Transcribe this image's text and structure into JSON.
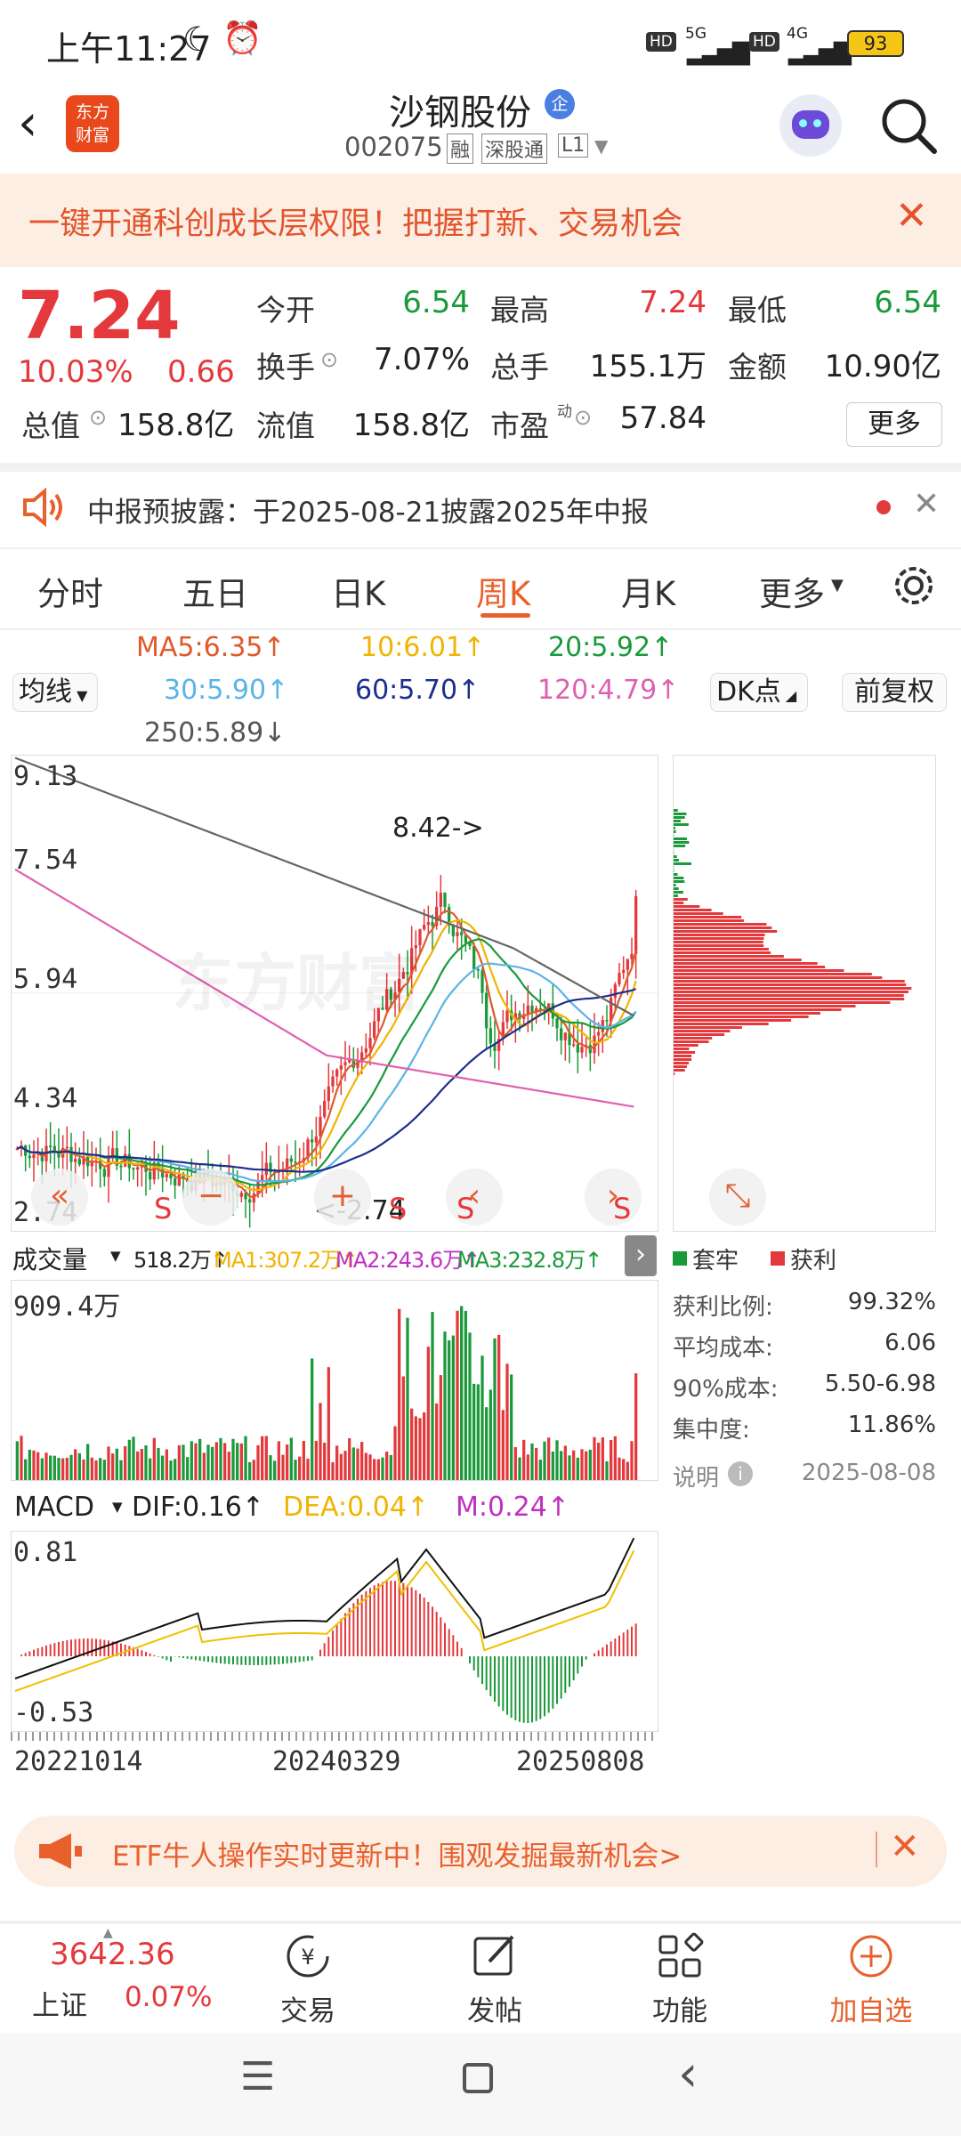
{
  "status": {
    "time": "上午11:27",
    "battery": "93",
    "net1": "5G",
    "net2": "4G",
    "hd1": "HD",
    "hd2": "HD"
  },
  "nav": {
    "logo_line1": "东方",
    "logo_line2": "财富",
    "title": "沙钢股份",
    "title_badge": "企",
    "code": "002075",
    "tag1": "融",
    "tag2": "深股通",
    "tag3": "L1"
  },
  "banner": {
    "text": "一键开通科创成长层权限！把握打新、交易机会"
  },
  "quote": {
    "price": "7.24",
    "change_pct": "10.03%",
    "change": "0.66",
    "labels": {
      "open": "今开",
      "high": "最高",
      "low": "最低",
      "turnover": "换手",
      "volume": "总手",
      "amount": "金额",
      "mcap": "总值",
      "float": "流值",
      "pe": "市盈",
      "pe_sup": "动"
    },
    "values": {
      "open": "6.54",
      "high": "7.24",
      "low": "6.54",
      "turnover": "7.07%",
      "volume": "155.1万",
      "amount": "10.90亿",
      "mcap": "158.8亿",
      "float": "158.8亿",
      "pe": "57.84"
    },
    "more": "更多"
  },
  "notice": {
    "text": "中报预披露：于2025-08-21披露2025年中报"
  },
  "tabs": [
    "分时",
    "五日",
    "日K",
    "周K",
    "月K",
    "更多"
  ],
  "active_tab": "周K",
  "ma": {
    "ma5": "MA5:6.35↑",
    "ma10": "10:6.01↑",
    "ma20": "20:5.92↑",
    "ma30": "30:5.90↑",
    "ma60": "60:5.70↑",
    "ma120": "120:4.79↑",
    "ma250": "250:5.89↓"
  },
  "chips": {
    "junxian": "均线",
    "dk": "DK点",
    "fq": "前复权"
  },
  "colors": {
    "ma5": "#e05a2a",
    "ma10": "#f0b400",
    "ma20": "#1a9a3a",
    "ma30": "#5ab4e6",
    "ma60": "#1c2f8c",
    "ma120": "#e060b0",
    "ma250": "#666666",
    "up": "#e4393c",
    "down": "#1a9a3a"
  },
  "kline": {
    "y_labels": [
      "9.13",
      "7.54",
      "5.94",
      "4.34",
      "2.74"
    ],
    "high_anno": "8.42->",
    "low_anno": "<-2.74",
    "watermark": "东方财富"
  },
  "chip_legend": {
    "trapped": "套牢",
    "profit": "获利"
  },
  "chip_stats": [
    {
      "label": "获利比例:",
      "value": "99.32%"
    },
    {
      "label": "平均成本:",
      "value": "6.06"
    },
    {
      "label": "90%成本:",
      "value": "5.50-6.98"
    },
    {
      "label": "集中度:",
      "value": "11.86%"
    }
  ],
  "chip_note": "说明",
  "chip_date": "2025-08-08",
  "volume": {
    "name": "成交量",
    "v": "518.2万↑",
    "ma1": "MA1:307.2万↑",
    "ma2": "MA2:243.6万↑",
    "ma3": "MA3:232.8万↑",
    "max": "909.4万"
  },
  "macd": {
    "name": "MACD",
    "dif": "DIF:0.16↑",
    "dea": "DEA:0.04↑",
    "m": "M:0.24↑",
    "top": "0.81",
    "bottom": "-0.53"
  },
  "dates": [
    "20221014",
    "20240329",
    "20250808"
  ],
  "etf": {
    "text": "ETF牛人操作实时更新中！围观发掘最新机会>"
  },
  "index": {
    "value": "3642.36",
    "name": "上证",
    "pct": "0.07%"
  },
  "toolbar": {
    "trade": "交易",
    "post": "发帖",
    "func": "功能",
    "add": "加自选"
  }
}
